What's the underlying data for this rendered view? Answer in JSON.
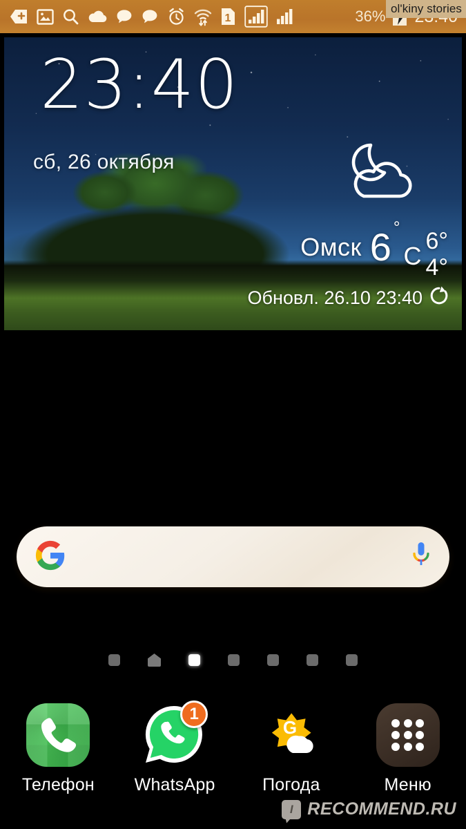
{
  "status_bar": {
    "icons": [
      {
        "name": "add-shortcut-icon",
        "label": "add"
      },
      {
        "name": "image-icon",
        "label": "screenshot"
      },
      {
        "name": "search-icon",
        "label": "search"
      },
      {
        "name": "cloud-icon",
        "label": "cloud-sync"
      },
      {
        "name": "message-bubble-icon",
        "label": "message"
      },
      {
        "name": "message-bubble-icon-2",
        "label": "message"
      },
      {
        "name": "alarm-clock-icon",
        "label": "alarm"
      },
      {
        "name": "wifi-data-icon",
        "label": "wifi"
      },
      {
        "name": "sim-card-icon",
        "label": "1"
      },
      {
        "name": "signal-bars-boxed-icon",
        "label": "signal-1"
      },
      {
        "name": "signal-bars-icon",
        "label": "signal-2"
      }
    ],
    "sim_label": "1",
    "battery_percent": "36%",
    "time": "23:40"
  },
  "watermark_top": {
    "text": "ol'kiny stories"
  },
  "clock_widget": {
    "time": "23:40",
    "date": "сб, 26 октября",
    "weather": {
      "icon": "moon-cloud-icon",
      "city": "Омск",
      "current_temp": "6",
      "degree": "°",
      "unit": "C",
      "high": "6°",
      "low": "4°",
      "updated": "Обновл. 26.10 23:40",
      "refresh_icon": "refresh-icon"
    }
  },
  "search_bar": {
    "google_icon": "google-g-icon",
    "value": "",
    "placeholder": "",
    "mic_icon": "microphone-icon"
  },
  "page_indicator": {
    "total": 7,
    "active_index": 2,
    "home_index": 1
  },
  "dock": {
    "items": [
      {
        "label": "Телефон",
        "icon": "phone-icon",
        "badge": ""
      },
      {
        "label": "WhatsApp",
        "icon": "whatsapp-icon",
        "badge": "1"
      },
      {
        "label": "Погода",
        "icon": "weather-g-icon",
        "badge": ""
      },
      {
        "label": "Меню",
        "icon": "apps-grid-icon",
        "badge": ""
      }
    ]
  },
  "watermark_bottom": {
    "logo_text": "I",
    "text": "RECOMMEND.RU"
  },
  "colors": {
    "status_bar_bg": "#bb762a",
    "wallpaper_gold": "#e8b25c",
    "widget_sky": "#122b50",
    "badge_orange": "#ef6c1f",
    "whatsapp_green": "#25d366",
    "phone_green": "#38bf48"
  }
}
